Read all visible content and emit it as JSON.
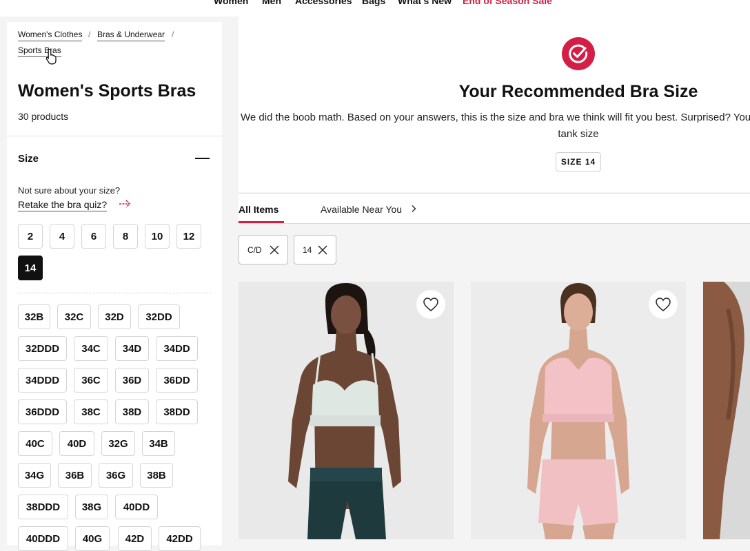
{
  "topnav": {
    "items": [
      "Women",
      "Men",
      "Accessories",
      "Bags",
      "What's New",
      "End of Season Sale"
    ]
  },
  "breadcrumb": {
    "items": [
      "Women's Clothes",
      "Bras & Underwear",
      "Sports Bras"
    ],
    "separator": "/"
  },
  "category": {
    "title": "Women's Sports Bras",
    "count": "30 products"
  },
  "filters": {
    "size": {
      "heading": "Size",
      "not_sure": "Not sure about your size?",
      "retake_label": "Retake the bra quiz?",
      "letter_sizes": [
        "2",
        "4",
        "6",
        "8",
        "10",
        "12",
        "14"
      ],
      "selected_size": "14",
      "cup_sizes": [
        "32B",
        "32C",
        "32D",
        "32DD",
        "32DDD",
        "34C",
        "34D",
        "34DD",
        "34DDD",
        "36C",
        "36D",
        "36DD",
        "36DDD",
        "38C",
        "38D",
        "38DD",
        "40C",
        "40D",
        "32G",
        "34B",
        "34G",
        "36B",
        "36G",
        "38B",
        "38DDD",
        "38G",
        "40DD",
        "40DDD",
        "40G",
        "42D",
        "42DD"
      ]
    }
  },
  "recommendation": {
    "title": "Your Recommended Bra Size",
    "description": "We did the boob math. Based on your answers, this is the size and bra we think will fit you best. Surprised? Your bra size may be different than your tank size",
    "size_badge": "SIZE 14"
  },
  "tabs": {
    "all_items": "All Items",
    "near_you": "Available Near You"
  },
  "active_filters": [
    "C/D",
    "14"
  ],
  "colors": {
    "accent": "#d31f45",
    "selected_chip": "#111111"
  },
  "icons": {
    "recommendation": "check-badge-icon",
    "wishlist": "heart-icon",
    "remove": "close-icon",
    "chevron": "chevron-right-icon",
    "arrow": "arrow-right-icon",
    "collapse": "minus-icon"
  }
}
